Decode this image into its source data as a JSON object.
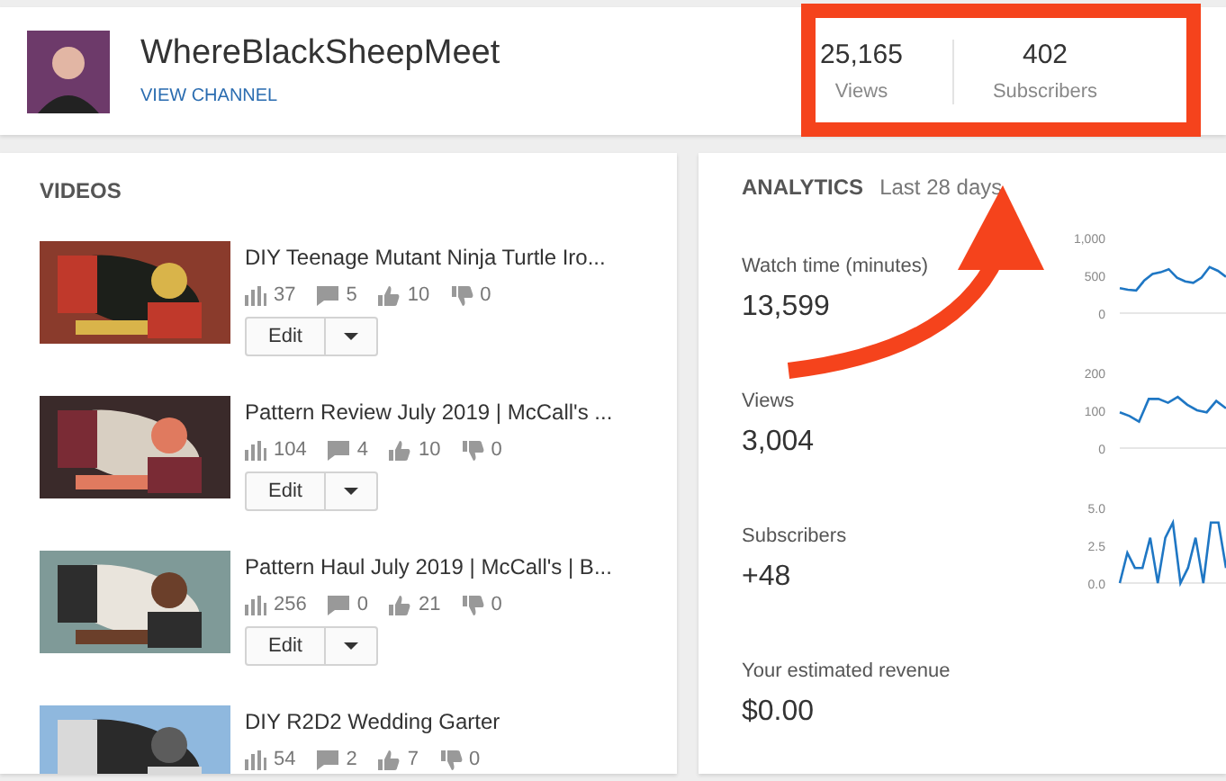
{
  "channel": {
    "name": "WhereBlackSheepMeet",
    "link": "VIEW CHANNEL"
  },
  "stats": [
    {
      "value": "25,165",
      "label": "Views"
    },
    {
      "value": "402",
      "label": "Subscribers"
    }
  ],
  "videos": {
    "heading": "VIDEOS",
    "items": [
      {
        "title": "DIY Teenage Mutant Ninja Turtle Iro...",
        "views": "37",
        "comments": "5",
        "likes": "10",
        "dislikes": "0",
        "edit": "Edit"
      },
      {
        "title": "Pattern Review July 2019 | McCall's ...",
        "views": "104",
        "comments": "4",
        "likes": "10",
        "dislikes": "0",
        "edit": "Edit"
      },
      {
        "title": "Pattern Haul July 2019 | McCall's | B...",
        "views": "256",
        "comments": "0",
        "likes": "21",
        "dislikes": "0",
        "edit": "Edit"
      },
      {
        "title": "DIY R2D2 Wedding Garter",
        "views": "54",
        "comments": "2",
        "likes": "7",
        "dislikes": "0"
      }
    ]
  },
  "analytics": {
    "heading": "ANALYTICS",
    "period": "Last 28 days",
    "metrics": [
      {
        "label": "Watch time (minutes)",
        "value": "13,599",
        "chart_data": {
          "type": "line",
          "yticks": [
            {
              "value": 0,
              "label": "0"
            },
            {
              "value": 500,
              "label": "500"
            },
            {
              "value": 1000,
              "label": "1,000"
            }
          ],
          "ylim": [
            0,
            1000
          ],
          "series": [
            {
              "color": "#1f77c4",
              "values": [
                330,
                310,
                300,
                430,
                520,
                540,
                580,
                470,
                420,
                400,
                470,
                610,
                560,
                480
              ]
            }
          ]
        }
      },
      {
        "label": "Views",
        "value": "3,004",
        "chart_data": {
          "type": "line",
          "yticks": [
            {
              "value": 0,
              "label": "0"
            },
            {
              "value": 100,
              "label": "100"
            },
            {
              "value": 200,
              "label": "200"
            }
          ],
          "ylim": [
            0,
            200
          ],
          "series": [
            {
              "color": "#1f77c4",
              "values": [
                95,
                85,
                70,
                130,
                130,
                120,
                135,
                115,
                100,
                95,
                125,
                105
              ]
            }
          ]
        }
      },
      {
        "label": "Subscribers",
        "value": "+48",
        "chart_data": {
          "type": "line",
          "yticks": [
            {
              "value": 0,
              "label": "0.0"
            },
            {
              "value": 2.5,
              "label": "2.5"
            },
            {
              "value": 5,
              "label": "5.0"
            }
          ],
          "ylim": [
            0,
            5
          ],
          "series": [
            {
              "color": "#1f77c4",
              "values": [
                0,
                2,
                1,
                1,
                3,
                0,
                3,
                4,
                0,
                1,
                3,
                0,
                4,
                4,
                1
              ]
            }
          ]
        }
      },
      {
        "label": "Your estimated revenue",
        "value": "$0.00"
      }
    ]
  },
  "annotations": {
    "highlight_frame": true,
    "arrow": true
  }
}
